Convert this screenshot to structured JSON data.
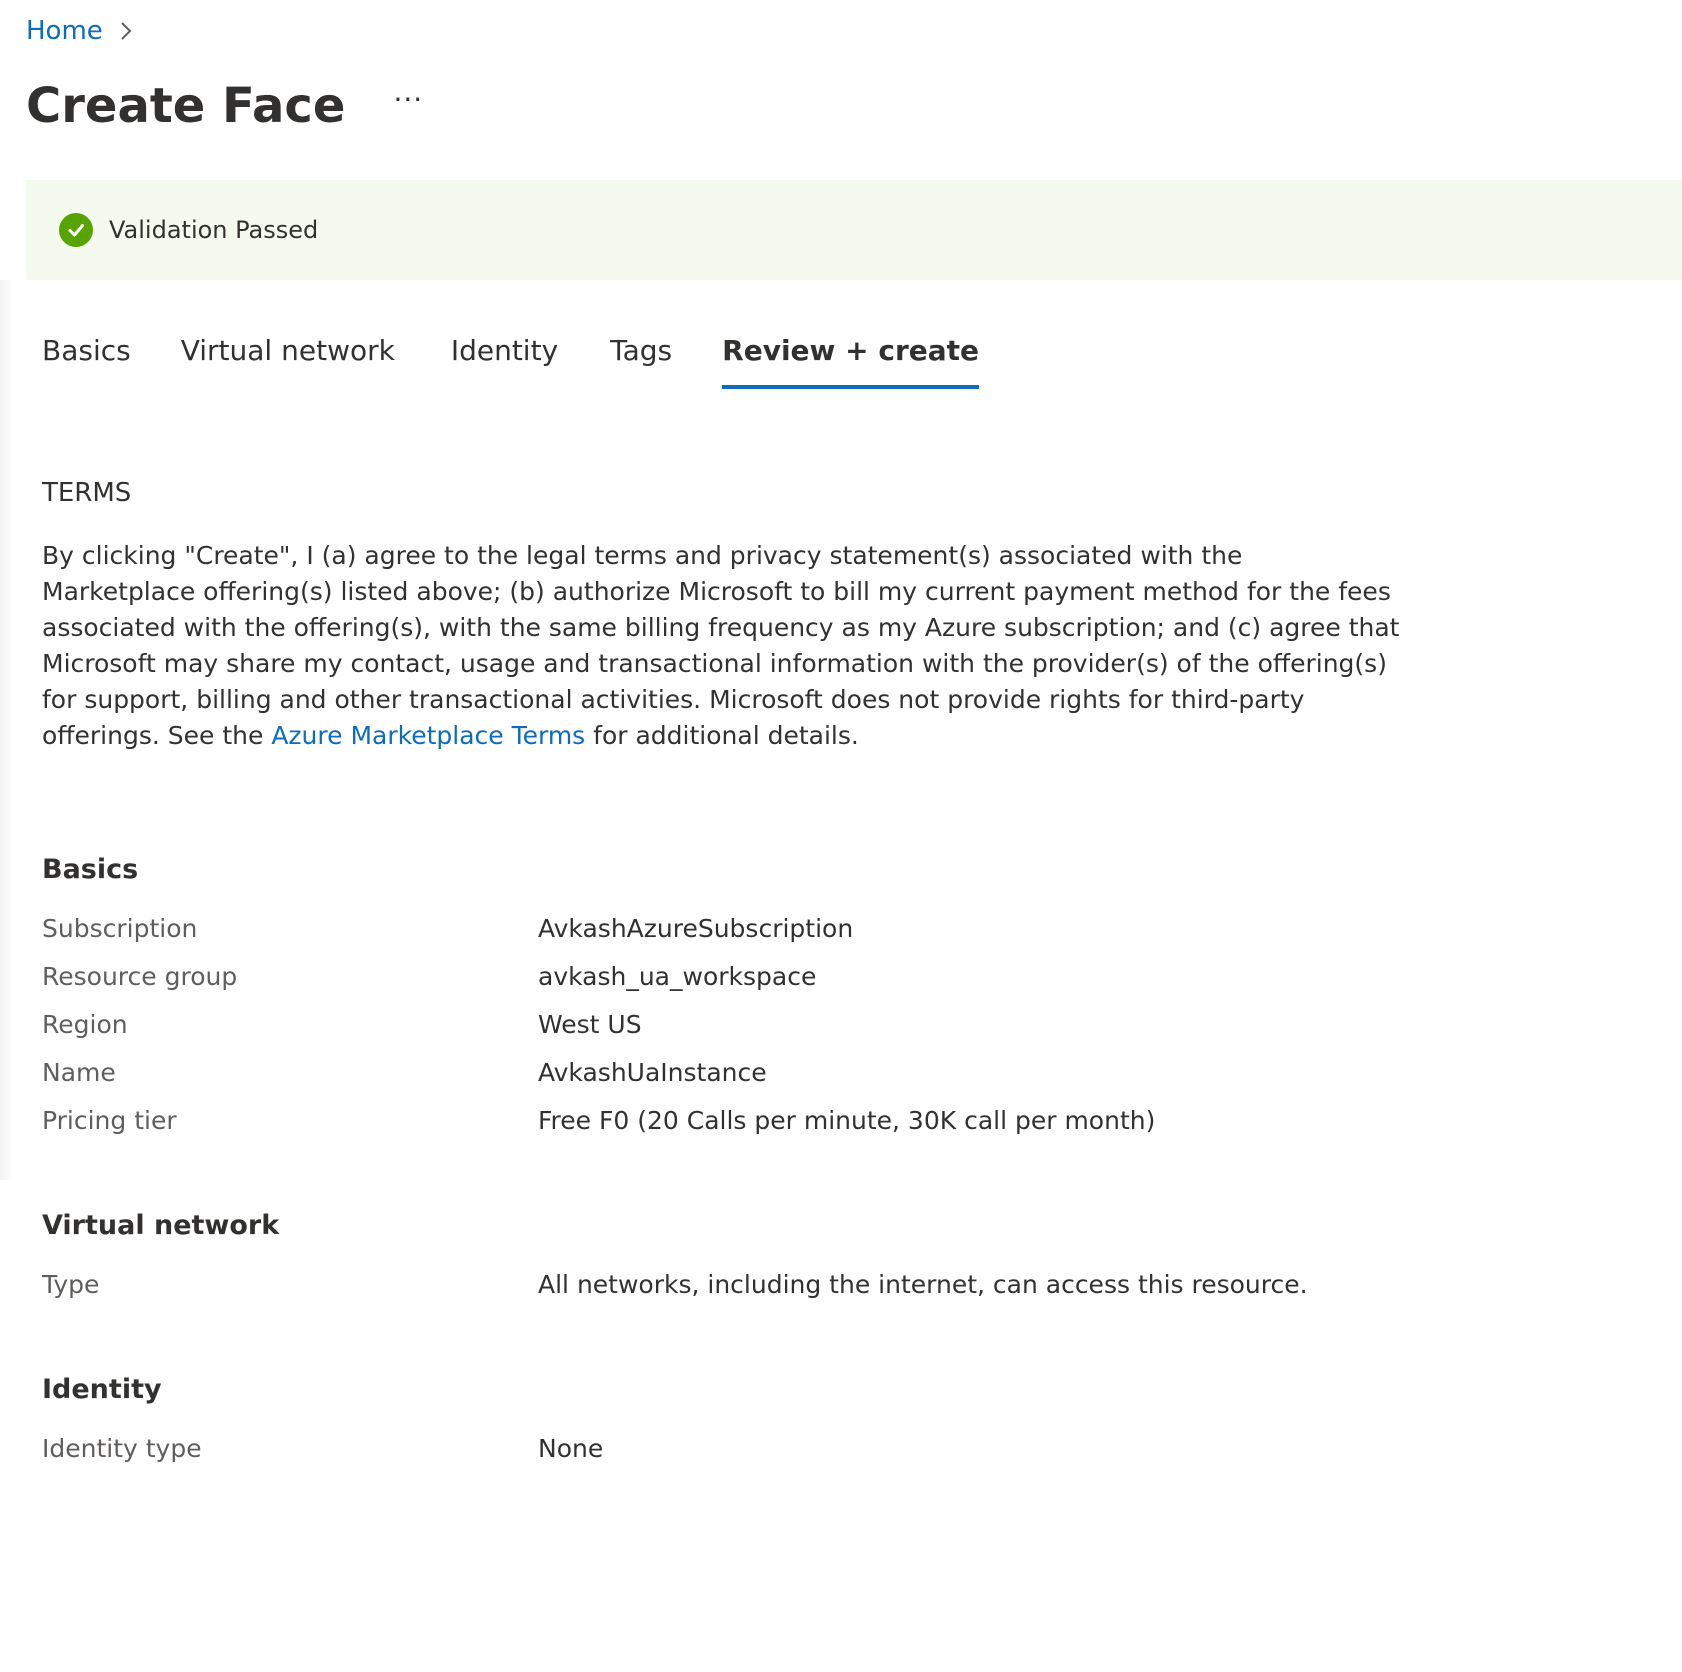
{
  "breadcrumb": {
    "home": "Home"
  },
  "page": {
    "title": "Create Face",
    "more": "···"
  },
  "validation": {
    "text": "Validation Passed",
    "status_color": "#57a300"
  },
  "tabs": [
    {
      "label": "Basics",
      "active": false
    },
    {
      "label": "Virtual network",
      "active": false
    },
    {
      "label": "Identity",
      "active": false
    },
    {
      "label": "Tags",
      "active": false
    },
    {
      "label": "Review + create",
      "active": true
    }
  ],
  "terms": {
    "heading": "TERMS",
    "body_before": "By clicking \"Create\", I (a) agree to the legal terms and privacy statement(s) associated with the Marketplace offering(s) listed above; (b) authorize Microsoft to bill my current payment method for the fees associated with the offering(s), with the same billing frequency as my Azure subscription; and (c) agree that Microsoft may share my contact, usage and transactional information with the provider(s) of the offering(s) for support, billing and other transactional activities. Microsoft does not provide rights for third-party offerings. See the ",
    "link": "Azure Marketplace Terms",
    "body_after": " for additional details."
  },
  "sections": {
    "basics": {
      "title": "Basics",
      "rows": [
        {
          "label": "Subscription",
          "value": "AvkashAzureSubscription"
        },
        {
          "label": "Resource group",
          "value": "avkash_ua_workspace"
        },
        {
          "label": "Region",
          "value": "West US"
        },
        {
          "label": "Name",
          "value": "AvkashUaInstance"
        },
        {
          "label": "Pricing tier",
          "value": "Free F0 (20 Calls per minute, 30K call per month)"
        }
      ]
    },
    "virtual_network": {
      "title": "Virtual network",
      "rows": [
        {
          "label": "Type",
          "value": "All networks, including the internet, can access this resource."
        }
      ]
    },
    "identity": {
      "title": "Identity",
      "rows": [
        {
          "label": "Identity type",
          "value": "None"
        }
      ]
    }
  },
  "colors": {
    "accent": "#0f6cbd",
    "validation_bg": "#f4fbee",
    "text": "#323130",
    "label_text": "#605e5c"
  },
  "icons": {
    "breadcrumb_separator": "chevron-right-icon",
    "validation": "check-circle-icon",
    "more": "more-ellipsis-icon"
  }
}
